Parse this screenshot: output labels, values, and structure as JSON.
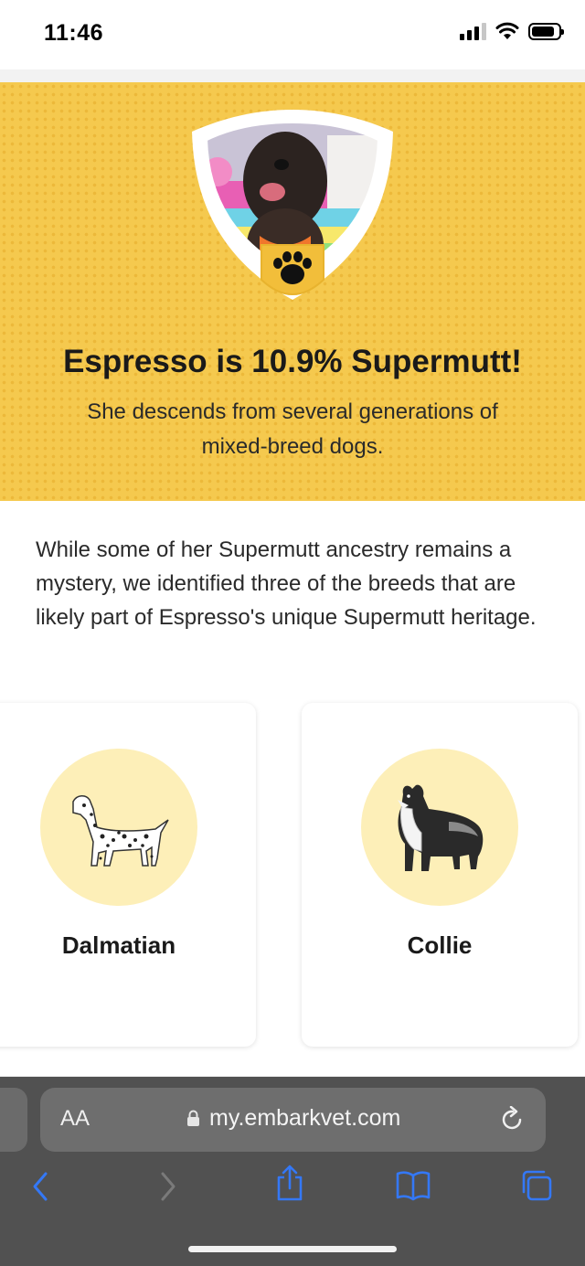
{
  "status": {
    "time": "11:46"
  },
  "hero": {
    "title": "Espresso is 10.9% Supermutt!",
    "subtitle": "She descends from several generations of mixed-breed dogs."
  },
  "intro": "While some of her Supermutt ancestry remains a mystery, we identified three of the breeds that are likely part of Espresso's unique Supermutt heritage.",
  "breeds": [
    {
      "name": "Dalmatian",
      "icon": "dalmatian-illustration"
    },
    {
      "name": "Collie",
      "icon": "collie-illustration"
    }
  ],
  "browser": {
    "aa_label": "AA",
    "url": "my.embarkvet.com"
  },
  "colors": {
    "hero_bg": "#f5c94e",
    "breed_circle": "#fdefb8",
    "ios_blue": "#3478f6"
  }
}
